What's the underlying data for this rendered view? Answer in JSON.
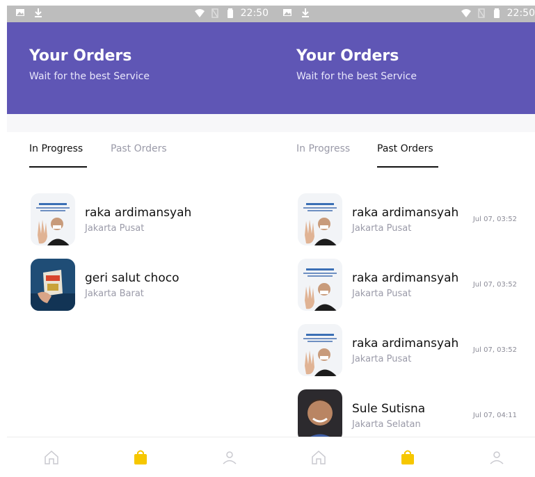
{
  "status_bar": {
    "time": "22:50"
  },
  "screens": [
    {
      "header": {
        "title": "Your Orders",
        "subtitle": "Wait for the best Service"
      },
      "tabs": [
        {
          "label": "In Progress",
          "active": true
        },
        {
          "label": "Past Orders",
          "active": false
        }
      ],
      "orders": [
        {
          "name": "raka ardimansyah",
          "city": "Jakarta Pusat",
          "date": ""
        },
        {
          "name": "geri salut choco",
          "city": "Jakarta Barat",
          "date": ""
        }
      ]
    },
    {
      "header": {
        "title": "Your Orders",
        "subtitle": "Wait for the best Service"
      },
      "tabs": [
        {
          "label": "In Progress",
          "active": false
        },
        {
          "label": "Past Orders",
          "active": true
        }
      ],
      "orders": [
        {
          "name": "raka ardimansyah",
          "city": "Jakarta Pusat",
          "date": "Jul 07, 03:52"
        },
        {
          "name": "raka ardimansyah",
          "city": "Jakarta Pusat",
          "date": "Jul 07, 03:52"
        },
        {
          "name": "raka ardimansyah",
          "city": "Jakarta Pusat",
          "date": "Jul 07, 03:52"
        },
        {
          "name": "Sule Sutisna",
          "city": "Jakarta Selatan",
          "date": "Jul 07, 04:11"
        }
      ]
    }
  ],
  "bottom_nav": [
    {
      "icon": "home-icon",
      "active": false
    },
    {
      "icon": "shopping-bag-icon",
      "active": true
    },
    {
      "icon": "profile-icon",
      "active": false
    }
  ],
  "colors": {
    "primary": "#5f56b5",
    "accent": "#f6c700",
    "muted": "#9a9aa8"
  }
}
